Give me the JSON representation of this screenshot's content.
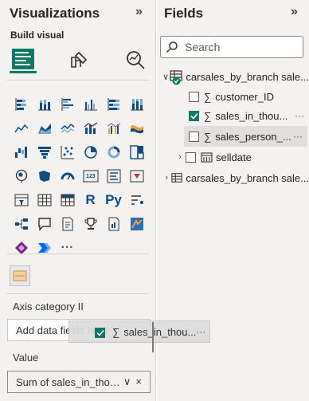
{
  "visualizations": {
    "title": "Visualizations",
    "collapse_glyph": "»",
    "build_visual_label": "Build visual",
    "build_buttons": [
      {
        "icon": "build-visual-icon",
        "active": true
      },
      {
        "icon": "format-visual-icon",
        "active": false
      },
      {
        "icon": "analytics-icon",
        "active": false
      }
    ],
    "visual_icons": [
      [
        "stacked-bar-chart-icon",
        "stacked-column-chart-icon",
        "clustered-bar-chart-icon",
        "clustered-column-chart-icon",
        "100-stacked-bar-chart-icon",
        "100-stacked-column-chart-icon"
      ],
      [
        "line-chart-icon",
        "area-chart-icon",
        "stacked-area-chart-icon",
        "line-and-column-chart-icon",
        "line-and-clustered-column-chart-icon",
        "ribbon-chart-icon"
      ],
      [
        "waterfall-chart-icon",
        "funnel-chart-icon",
        "scatter-chart-icon",
        "pie-chart-icon",
        "donut-chart-icon",
        "treemap-icon"
      ],
      [
        "map-icon",
        "filled-map-icon",
        "gauge-icon",
        "card-icon",
        "multi-row-card-icon",
        "kpi-icon"
      ],
      [
        "slicer-icon",
        "table-icon",
        "matrix-icon",
        "r-script-visual-icon",
        "python-visual-icon",
        "key-influencers-icon"
      ],
      [
        "decomposition-tree-icon",
        "qa-icon",
        "smart-narrative-icon",
        "trophy-icon",
        "paginated-report-icon",
        "azure-map-icon"
      ],
      [
        "power-apps-icon",
        "power-automate-icon",
        "more-visuals-icon"
      ]
    ],
    "r_label": "R",
    "py_label": "Py",
    "more_label": "···",
    "wells": {
      "axis_label": "Axis category II",
      "axis_placeholder": "Add data fields here",
      "value_label": "Value",
      "value_field": "Sum of sales_in_thous...",
      "chevron": "∨",
      "remove": "×"
    }
  },
  "fields": {
    "title": "Fields",
    "collapse_glyph": "»",
    "search_placeholder": "Search",
    "tables": [
      {
        "name": "carsales_by_branch sale...",
        "expanded": true,
        "fields": [
          {
            "name": "customer_ID",
            "checked": false,
            "type": "sigma"
          },
          {
            "name": "sales_in_thou...",
            "checked": true,
            "type": "sigma",
            "more": "···"
          },
          {
            "name": "sales_person_...",
            "checked": false,
            "type": "sigma",
            "more": "···"
          },
          {
            "name": "selldate",
            "checked": false,
            "type": "calendar",
            "collapsed": true
          }
        ]
      },
      {
        "name": "carsales_by_branch sale...",
        "expanded": false
      }
    ]
  },
  "drag_ghost": {
    "label": "sales_in_thou...",
    "more": "···",
    "sigma": "∑"
  },
  "colors": {
    "accent": "#117865",
    "pane_bg": "#f3f2f1",
    "icon_blue": "#0f4c81",
    "icon_orange": "#e8a33d"
  }
}
